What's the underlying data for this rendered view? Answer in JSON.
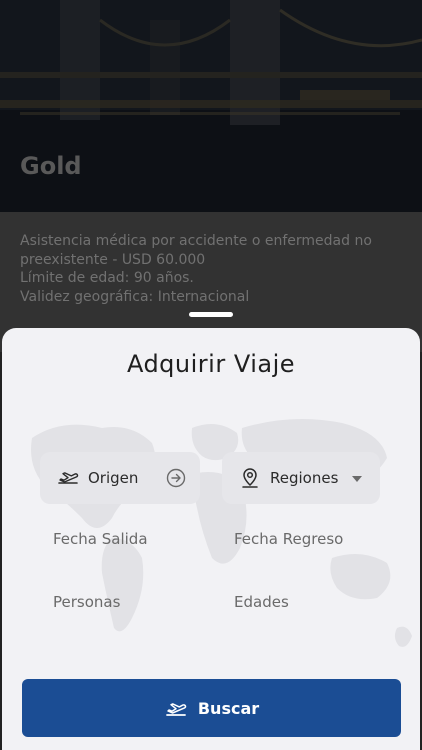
{
  "plan": {
    "title": "Gold",
    "details": [
      "Asistencia médica por accidente o enfermedad no",
      "preexistente - USD 60.000",
      "Límite de edad: 90 años.",
      "Validez geográfica: Internacional"
    ]
  },
  "sheet": {
    "title": "Adquirir Viaje",
    "origin_label": "Origen",
    "regions_label": "Regiones",
    "departure_label": "Fecha Salida",
    "return_label": "Fecha Regreso",
    "persons_label": "Personas",
    "ages_label": "Edades",
    "search_label": "Buscar"
  },
  "icons": {
    "origin": "plane-takeoff-icon",
    "origin_action": "arrow-right-circle-icon",
    "regions": "map-pin-icon",
    "regions_action": "caret-down-icon",
    "search": "plane-takeoff-icon"
  },
  "colors": {
    "accent": "#1b4d94",
    "sheet_bg": "#f2f2f5",
    "chip_bg": "#e6e6ea"
  }
}
